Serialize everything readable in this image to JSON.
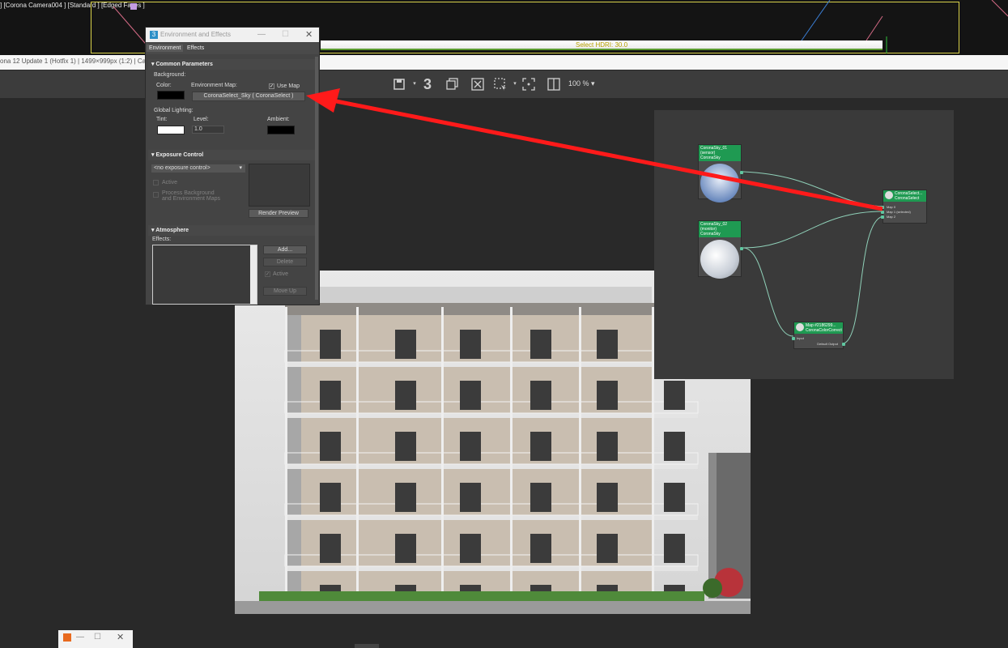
{
  "viewport": {
    "label": "] [Corona Camera004 ] [Standard ] [Edged Faces ]",
    "hdri_label": "Select HDRI: 30.0",
    "vfb_info": "ona 12 Update 1 (Hotfix 1) | 1499×999px (1:2) | Came"
  },
  "toolbar": {
    "zoom": "100 %",
    "icons": [
      "save-icon",
      "three-icon",
      "copy-icon",
      "clear-icon",
      "region-icon",
      "focus-icon",
      "split-icon"
    ],
    "three_glyph": "3"
  },
  "env_dialog": {
    "title": "Environment and Effects",
    "tabs": [
      "Environment",
      "Effects"
    ],
    "common": {
      "header": "Common Parameters",
      "background": "Background:",
      "color": "Color:",
      "env_map": "Environment Map:",
      "use_map": "Use Map",
      "map_button": "CoronaSelect_Sky  ( CoronaSelect )",
      "global_lighting": "Global Lighting:",
      "tint": "Tint:",
      "level": "Level:",
      "level_value": "1.0",
      "ambient": "Ambient:"
    },
    "exposure": {
      "header": "Exposure Control",
      "dropdown": "<no exposure control>",
      "active": "Active",
      "process": "Process Background",
      "process2": "and Environment Maps",
      "render_preview": "Render Preview"
    },
    "atmosphere": {
      "header": "Atmosphere",
      "effects": "Effects:",
      "add": "Add...",
      "delete": "Delete",
      "active": "Active",
      "move_up": "Move Up"
    }
  },
  "node_editor": {
    "nodes": [
      {
        "title": "CoronaSky_01 (sensor)",
        "sub": "CoronaSky"
      },
      {
        "title": "CoronaSky_02 (monitor)",
        "sub": "CoronaSky"
      },
      {
        "title": "CoronaSelect...",
        "sub": "CoronaSelect",
        "ports": [
          "Map 0",
          "Map 1 (selected)",
          "Map 2"
        ]
      },
      {
        "title": "Map #2186299...",
        "sub": "CoronaColorCorrect",
        "ports": [
          "Input",
          "Default Output"
        ]
      }
    ]
  },
  "colors": {
    "arrow": "#ff1a1a",
    "node_header": "#1f9a52",
    "viewport_frame": "#d9d24a"
  }
}
